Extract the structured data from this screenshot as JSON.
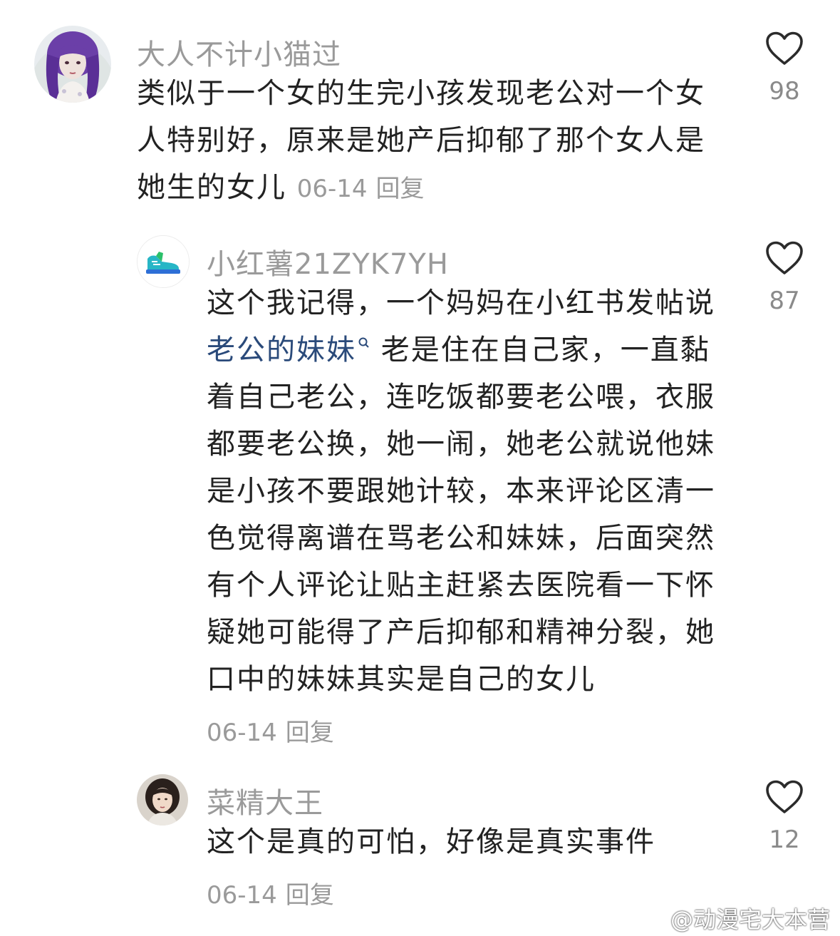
{
  "comments": [
    {
      "username": "大人不计小猫过",
      "avatar_icon": "anime-girl-purple-hair-avatar",
      "lines": [
        "类似于一个女的生完小孩发现老公对一个女",
        "人特别好，原来是她产后抑郁了那个女人是",
        "她生的女儿"
      ],
      "date": "06-14",
      "reply_label": "回复",
      "likes": "98"
    },
    {
      "username": "小红薯21ZYK7YH",
      "avatar_icon": "sneaker-avatar",
      "keyword_link": "老公的妹妹",
      "line2_rest": "老是住在自己家，一直黏",
      "lines": [
        "这个我记得，一个妈妈在小红书发帖说",
        "着自己老公，连吃饭都要老公喂，衣服",
        "都要老公换，她一闹，她老公就说他妹",
        "是小孩不要跟她计较，本来评论区清一",
        "色觉得离谱在骂老公和妹妹，后面突然",
        "有个人评论让贴主赶紧去医院看一下怀",
        "疑她可能得了产后抑郁和精神分裂，她",
        "口中的妹妹其实是自己的女儿"
      ],
      "date": "06-14",
      "reply_label": "回复",
      "likes": "87"
    },
    {
      "username": "菜精大王",
      "avatar_icon": "retro-girl-portrait-avatar",
      "lines": [
        "这个是真的可怕，好像是真实事件"
      ],
      "date": "06-14",
      "reply_label": "回复",
      "likes": "12"
    }
  ],
  "watermark": "@动漫宅大本营",
  "colors": {
    "username": "#9a9a9a",
    "text": "#222222",
    "keyword_link": "#2a4a7a",
    "meta": "#9a9a9a"
  }
}
